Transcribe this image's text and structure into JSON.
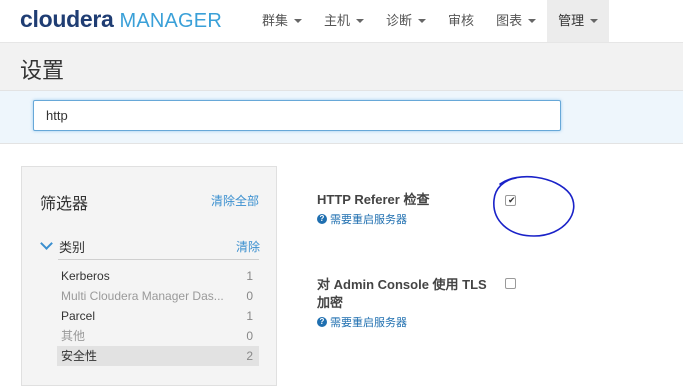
{
  "logo": {
    "brand": "cloudera",
    "product": "MANAGER"
  },
  "nav": [
    {
      "label": "群集",
      "dropdown": true
    },
    {
      "label": "主机",
      "dropdown": true
    },
    {
      "label": "诊断",
      "dropdown": true
    },
    {
      "label": "审核",
      "dropdown": false
    },
    {
      "label": "图表",
      "dropdown": true
    },
    {
      "label": "管理",
      "dropdown": true,
      "active": true
    }
  ],
  "page": {
    "title": "设置"
  },
  "search": {
    "value": "http"
  },
  "filters": {
    "title": "筛选器",
    "clear_all": "清除全部",
    "category": {
      "label": "类别",
      "clear": "清除"
    },
    "items": [
      {
        "label": "Kerberos",
        "count": "1"
      },
      {
        "label": "Multi Cloudera Manager Das...",
        "count": "0"
      },
      {
        "label": "Parcel",
        "count": "1"
      },
      {
        "label": "其他",
        "count": "0"
      },
      {
        "label": "安全性",
        "count": "2"
      }
    ]
  },
  "settings": [
    {
      "label": "HTTP Referer 检查",
      "note": "需要重启服务器",
      "checked": true
    },
    {
      "label_line1": "对 Admin Console 使用 TLS",
      "label_line2": "加密",
      "note": "需要重启服务器",
      "checked": false
    }
  ],
  "colors": {
    "link": "#3a8fcf",
    "brand": "#1f3d73",
    "annotation": "#1a22c8"
  }
}
